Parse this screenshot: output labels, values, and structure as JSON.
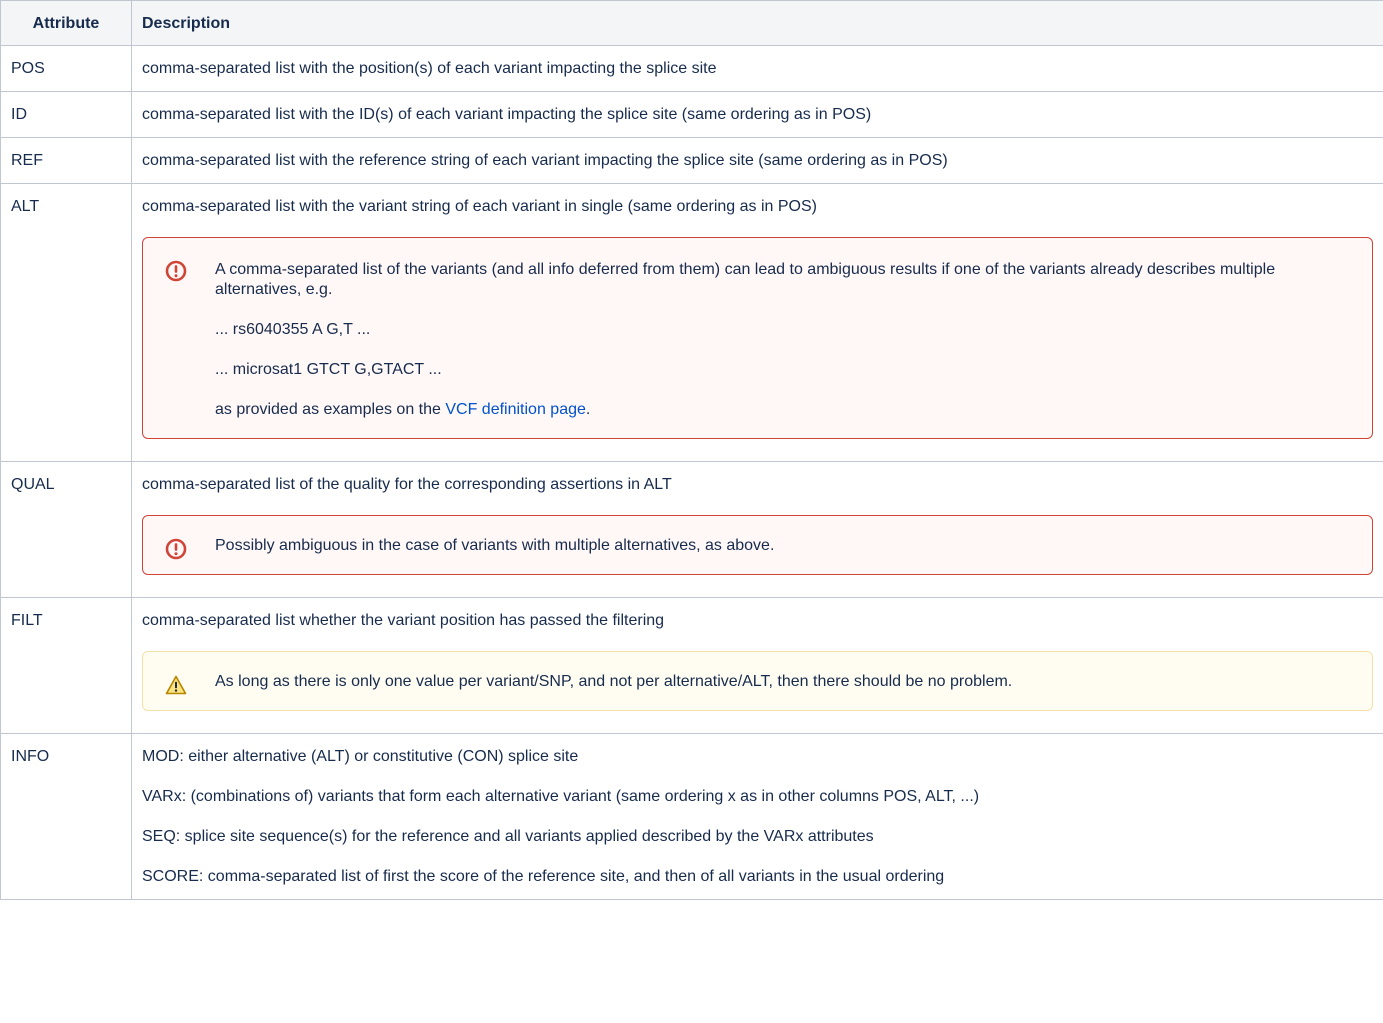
{
  "header": {
    "attribute": "Attribute",
    "description": "Description"
  },
  "rows": {
    "pos": {
      "attr": "POS",
      "desc": "comma-separated list with the position(s) of each variant impacting the splice site"
    },
    "id": {
      "attr": "ID",
      "desc": "comma-separated list with the ID(s) of each variant impacting the splice site (same ordering as in POS)"
    },
    "ref": {
      "attr": "REF",
      "desc": "comma-separated list with the reference string of each variant impacting the splice site (same ordering as in POS)"
    },
    "alt": {
      "attr": "ALT",
      "desc": "comma-separated list with the variant string of each variant in single (same ordering as in POS)",
      "panel": {
        "line1": "A comma-separated list of the variants (and all info deferred from them) can lead to ambiguous results if one of the variants already describes multiple alternatives, e.g.",
        "line2": "... rs6040355 A G,T ...",
        "line3": "... microsat1 GTCT G,GTACT ...",
        "line4_prefix": "as provided as examples on the ",
        "link_text": "VCF definition page",
        "line4_suffix": "."
      }
    },
    "qual": {
      "attr": "QUAL",
      "desc": "comma-separated list of the quality for the corresponding assertions in ALT",
      "panel": {
        "text": "Possibly ambiguous in the case of variants with multiple alternatives, as above."
      }
    },
    "filt": {
      "attr": "FILT",
      "desc": "comma-separated list whether the variant position has passed the filtering",
      "panel": {
        "text": "As long as there is only one value per variant/SNP, and not per alternative/ALT, then there should be no problem."
      }
    },
    "info": {
      "attr": "INFO",
      "lines": [
        "MOD: either alternative (ALT) or constitutive (CON) splice site",
        "VARx: (combinations of) variants that form each alternative variant (same ordering x as in other columns POS, ALT, ...)",
        "SEQ: splice site sequence(s) for the reference and all variants applied described by the VARx attributes",
        "SCORE: comma-separated list of first the score of the reference site, and then of all variants in the usual ordering"
      ]
    }
  },
  "colors": {
    "error_border": "#d04437",
    "warning_border": "#f5e1a8",
    "link": "#0052cc",
    "header_bg": "#f4f5f7"
  }
}
